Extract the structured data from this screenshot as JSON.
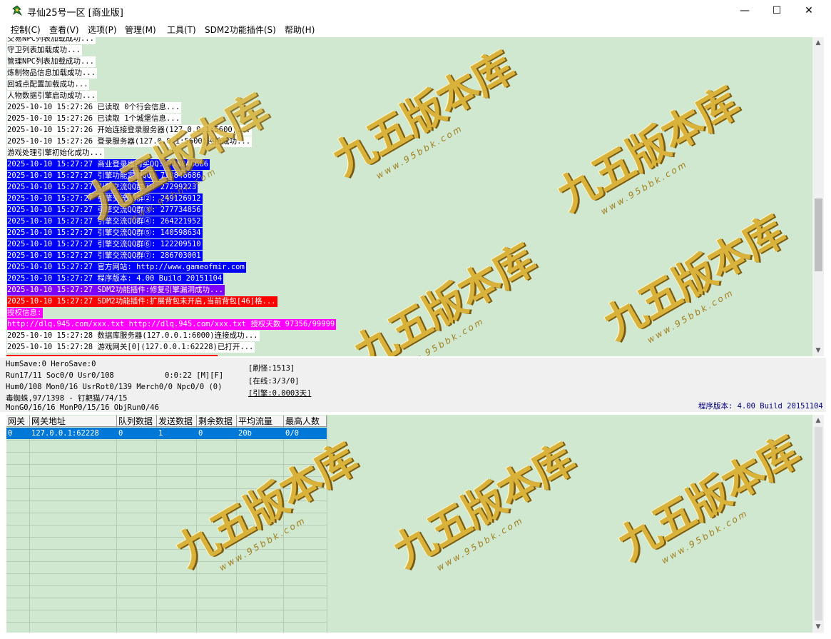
{
  "window": {
    "title": "寻仙25号一区 [商业版]",
    "minimize_glyph": "—",
    "maximize_glyph": "☐",
    "close_glyph": "✕"
  },
  "menu": [
    "控制(C)",
    "查看(V)",
    "选项(P)",
    "管理(M)",
    "工具(T)",
    "SDM2功能插件(S)",
    "帮助(H)"
  ],
  "log": {
    "lines": [
      {
        "text": "交易NPC列表加载成功...",
        "color": "#000000",
        "bg": "#ffffff"
      },
      {
        "text": "守卫列表加载成功...",
        "color": "#000000",
        "bg": "#ffffff"
      },
      {
        "text": "管理NPC列表加载成功...",
        "color": "#000000",
        "bg": "#ffffff"
      },
      {
        "text": "炼制物品信息加载成功...",
        "color": "#000000",
        "bg": "#ffffff"
      },
      {
        "text": "回城点配置加载成功...",
        "color": "#000000",
        "bg": "#ffffff"
      },
      {
        "text": "人物数据引擎启动成功...",
        "color": "#000000",
        "bg": "#ffffff"
      },
      {
        "text": "2025-10-10 15:27:26 已读取 0个行会信息...",
        "color": "#000000",
        "bg": "#ffffff"
      },
      {
        "text": "2025-10-10 15:27:26 已读取 1个城堡信息...",
        "color": "#000000",
        "bg": "#ffffff"
      },
      {
        "text": "2025-10-10 15:27:26 开始连接登录服务器(127.0.0.1:5600)...",
        "color": "#000000",
        "bg": "#ffffff"
      },
      {
        "text": "2025-10-10 15:27:26 登录服务器(127.0.0.1:5600)连接成功...",
        "color": "#000000",
        "bg": "#ffffff"
      },
      {
        "text": "游戏处理引擎初始化成功...",
        "color": "#000000",
        "bg": "#ffffff"
      },
      {
        "text": "2025-10-10 15:27:27 商业登录器购买QQ: 718846686",
        "color": "#ffffff",
        "bg": "#0000ff"
      },
      {
        "text": "2025-10-10 15:27:27 引擎功能定制QQ: 718846686",
        "color": "#ffffff",
        "bg": "#0000ff"
      },
      {
        "text": "2025-10-10 15:27:27 引擎交流QQ群①: 27299223",
        "color": "#ffffff",
        "bg": "#0000ff"
      },
      {
        "text": "2025-10-10 15:27:27 引擎交流QQ群②: 249126912",
        "color": "#ffffff",
        "bg": "#0000ff"
      },
      {
        "text": "2025-10-10 15:27:27 引擎交流QQ群③: 277734856",
        "color": "#ffffff",
        "bg": "#0000ff"
      },
      {
        "text": "2025-10-10 15:27:27 引擎交流QQ群④: 264221952",
        "color": "#ffffff",
        "bg": "#0000ff"
      },
      {
        "text": "2025-10-10 15:27:27 引擎交流QQ群⑤: 140598634",
        "color": "#ffffff",
        "bg": "#0000ff"
      },
      {
        "text": "2025-10-10 15:27:27 引擎交流QQ群⑥: 122209510",
        "color": "#ffffff",
        "bg": "#0000ff"
      },
      {
        "text": "2025-10-10 15:27:27 引擎交流QQ群⑦: 286703001",
        "color": "#ffffff",
        "bg": "#0000ff"
      },
      {
        "text": "2025-10-10 15:27:27 官方网站: http://www.gameofmir.com",
        "color": "#ffffff",
        "bg": "#0000ff"
      },
      {
        "text": "2025-10-10 15:27:27 程序版本: 4.00 Build 20151104",
        "color": "#ffffff",
        "bg": "#0000ff"
      },
      {
        "text": "2025-10-10 15:27:27 SDM2功能插件:修复引擎漏洞成功...",
        "color": "#ffffff",
        "bg": "#8000ff"
      },
      {
        "text": "2025-10-10 15:27:27 SDM2功能插件:扩展背包未开启,当前背包[46]格...",
        "color": "#ffffff",
        "bg": "#ff0000"
      },
      {
        "text": "授权信息:",
        "color": "#ffffff",
        "bg": "#ff00ff"
      },
      {
        "text": "http://dlq.945.com/xxx.txt http://dlq.945.com/xxx.txt 授权天数 97356/99999",
        "color": "#ffffff",
        "bg": "#ff00ff"
      },
      {
        "text": "2025-10-10 15:27:28 数据库服务器(127.0.0.1:6000)连接成功...",
        "color": "#000000",
        "bg": "#ffffff"
      },
      {
        "text": "2025-10-10 15:27:28 游戏网关[0](127.0.0.1:62228)已打开...",
        "color": "#000000",
        "bg": "#ffffff"
      }
    ]
  },
  "status": {
    "line1": "HumSave:0 HeroSave:0",
    "line2": "Run17/11 Soc0/0 Usr0/108",
    "timer": "0:0:22 [M][F]",
    "line3": "Hum0/108 Mon0/16 UsrRot0/139 Merch0/0 Npc0/0 (0)",
    "line4": "毒蜘蛛,97/1398 - 钉耙猫/74/15",
    "line5": "MonG0/16/16 MonP0/15/16 ObjRun0/46",
    "refresh": "[刷怪:1513]",
    "online": "[在线:3/3/0]",
    "engine": "[引擎:0.0003天]",
    "version": "程序版本: 4.00 Build 20151104"
  },
  "gateway_table": {
    "columns": [
      "网关",
      "网关地址",
      "队列数据",
      "发送数据",
      "剩余数据",
      "平均流量",
      "最高人数"
    ],
    "rows": [
      [
        "0",
        "127.0.0.1:62228",
        "0",
        "1",
        "0",
        "20b",
        "0/0"
      ]
    ]
  },
  "watermark": {
    "text": "九五版本库",
    "url": "www.95bbk.com",
    "color": "#d8b23a"
  },
  "colors": {
    "pane_bg": "#cfe8cf",
    "selection": "#0078d7"
  }
}
